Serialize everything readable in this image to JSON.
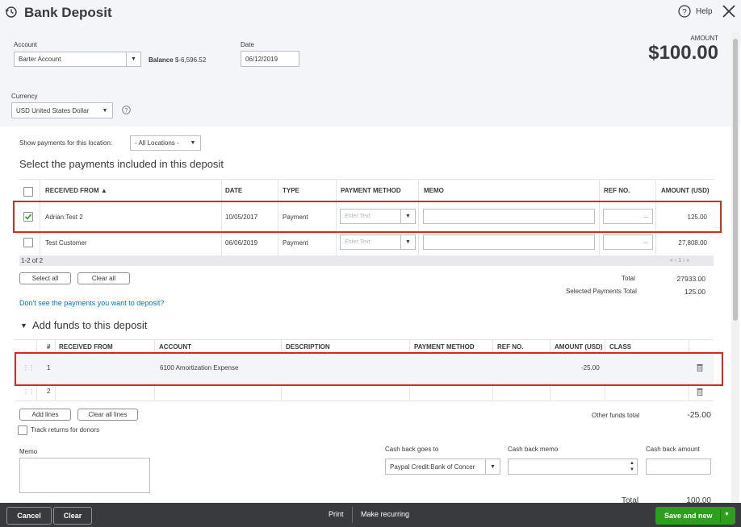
{
  "header": {
    "title": "Bank Deposit",
    "help_label": "Help",
    "amount_label": "AMOUNT",
    "amount_value": "$100.00"
  },
  "account": {
    "label": "Account",
    "value": "Barter Account",
    "balance_label": "Balance",
    "balance_value": "$-6,596.52"
  },
  "date": {
    "label": "Date",
    "value": "06/12/2019"
  },
  "currency": {
    "label": "Currency",
    "value": "USD United States Dollar"
  },
  "location": {
    "label": "Show payments for this location:",
    "value": "- All Locations -"
  },
  "payments_section": {
    "title": "Select the payments included in this deposit",
    "columns": [
      "RECEIVED FROM ▲",
      "DATE",
      "TYPE",
      "PAYMENT METHOD",
      "MEMO",
      "REF NO.",
      "AMOUNT (USD)"
    ],
    "rows": [
      {
        "received_from": "Adrian:Test 2",
        "date": "10/05/2017",
        "type": "Payment",
        "method_placeholder": "Enter Text",
        "amount": "125.00",
        "checked": true
      },
      {
        "received_from": "Test Customer",
        "date": "06/06/2019",
        "type": "Payment",
        "method_placeholder": "Enter Text",
        "amount": "27,808.00",
        "checked": false
      }
    ],
    "pagination": "1-2 of 2",
    "pager": "«  ‹  1  ›  »",
    "select_all": "Select all",
    "clear_all": "Clear all",
    "total_label": "Total",
    "total_value": "27933.00",
    "selected_label": "Selected Payments Total",
    "selected_value": "125.00",
    "missing_link": "Don't see the payments you want to deposit?"
  },
  "funds_section": {
    "title": "Add funds to this deposit",
    "columns": [
      "#",
      "RECEIVED FROM",
      "ACCOUNT",
      "DESCRIPTION",
      "PAYMENT METHOD",
      "REF NO.",
      "AMOUNT (USD)",
      "CLASS"
    ],
    "rows": [
      {
        "num": "1",
        "account": "6100 Amortization Expense",
        "amount": "-25.00"
      },
      {
        "num": "2",
        "account": "",
        "amount": ""
      }
    ],
    "add_lines": "Add lines",
    "clear_all_lines": "Clear all lines",
    "track_returns": "Track returns for donors",
    "other_total_label": "Other funds total",
    "other_total_value": "-25.00"
  },
  "bottom": {
    "memo_label": "Memo",
    "cash_back_goes_to_label": "Cash back goes to",
    "cash_back_goes_to_value": "Paypal Credit:Bank of Concer",
    "cash_back_memo_label": "Cash back memo",
    "cash_back_amount_label": "Cash back amount",
    "total_label": "Total",
    "total_value": "100.00"
  },
  "footer": {
    "cancel": "Cancel",
    "clear": "Clear",
    "print": "Print",
    "make_recurring": "Make recurring",
    "save_and_new": "Save and new"
  },
  "colors": {
    "accent_green": "#2ca01c",
    "link_blue": "#0077c5",
    "highlight_red": "#d52b1e",
    "footer_dark": "#393a3d"
  }
}
